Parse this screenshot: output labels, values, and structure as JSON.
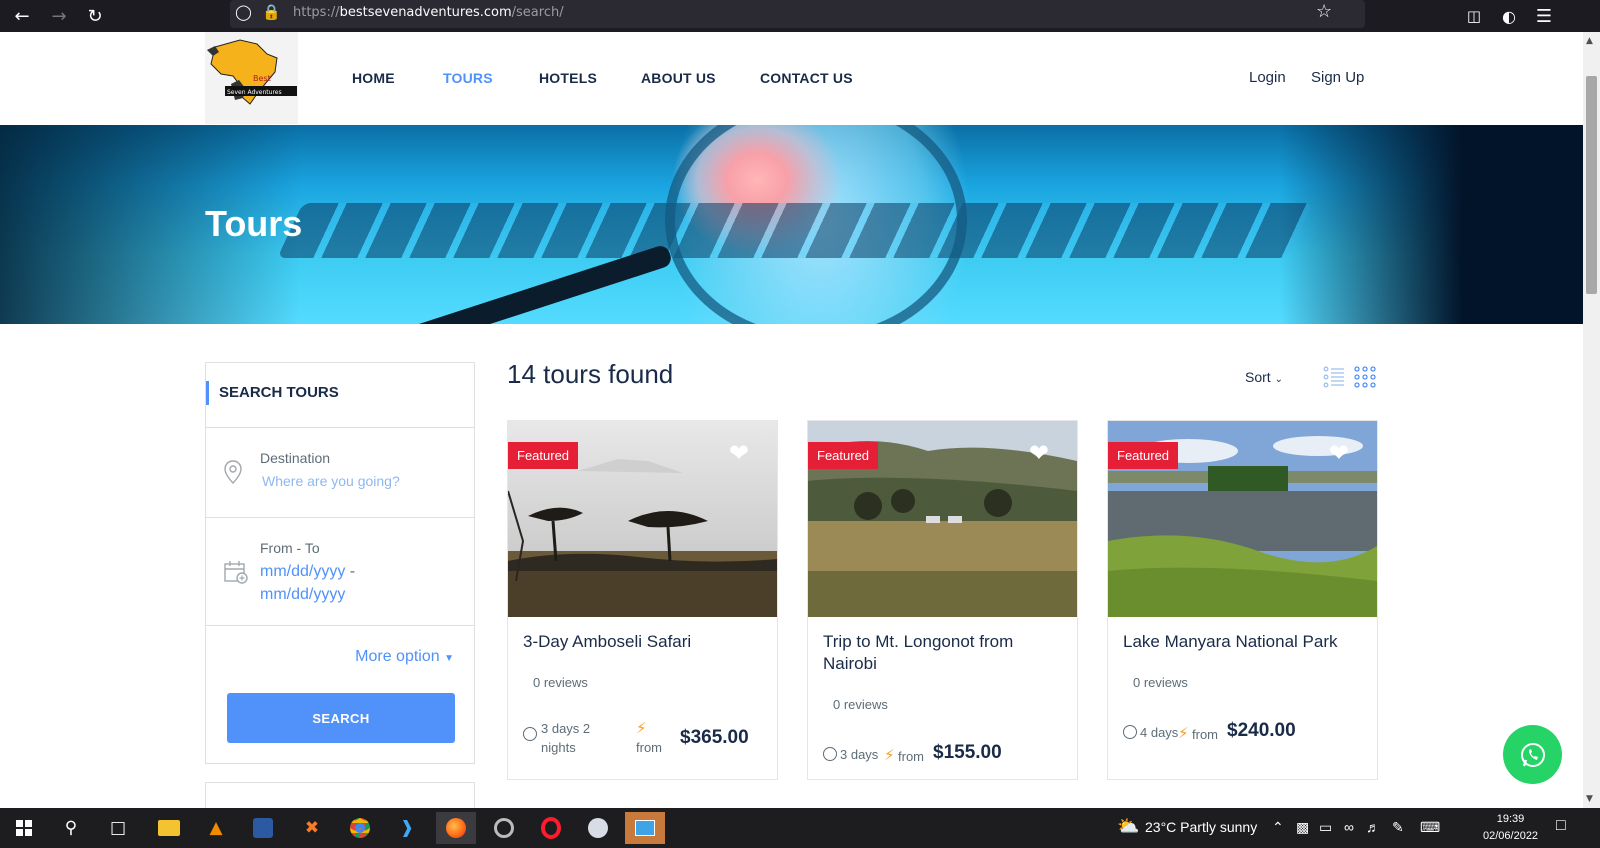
{
  "browser": {
    "url_prefix": "https://",
    "url_domain": "bestsevenadventures.com",
    "url_path": "/search/"
  },
  "header": {
    "logo_text_1": "Best",
    "logo_text_2": "Seven Adventures",
    "nav": [
      "HOME",
      "TOURS",
      "HOTELS",
      "ABOUT US",
      "CONTACT US"
    ],
    "active_nav": "TOURS",
    "login": "Login",
    "signup": "Sign Up"
  },
  "hero": {
    "title": "Tours"
  },
  "sidebar": {
    "title": "SEARCH TOURS",
    "destination_label": "Destination",
    "destination_placeholder": "Where are you going?",
    "dates_label": "From - To",
    "date_from": "mm/dd/yyyy",
    "date_sep": " -",
    "date_to": "mm/dd/yyyy",
    "more_option": "More option",
    "search_button": "SEARCH"
  },
  "results": {
    "count_text": "14 tours found",
    "sort_label": "Sort"
  },
  "tours": [
    {
      "featured": "Featured",
      "name": "3-Day Amboseli Safari",
      "reviews": "0 reviews",
      "duration": "3 days 2 nights",
      "from": "from",
      "price": "$365.00"
    },
    {
      "featured": "Featured",
      "name": "Trip to Mt. Longonot from Nairobi",
      "reviews": "0 reviews",
      "duration": "3 days",
      "from": "from",
      "price": "$155.00"
    },
    {
      "featured": "Featured",
      "name": "Lake Manyara National Park",
      "reviews": "0 reviews",
      "duration": "4 days",
      "from": "from",
      "price": "$240.00"
    }
  ],
  "taskbar": {
    "weather": "23°C  Partly sunny",
    "time": "19:39",
    "date": "02/06/2022"
  },
  "colors": {
    "accent": "#5191fa",
    "featured": "#e41f36",
    "whatsapp": "#25d366",
    "text": "#1a2b48"
  }
}
